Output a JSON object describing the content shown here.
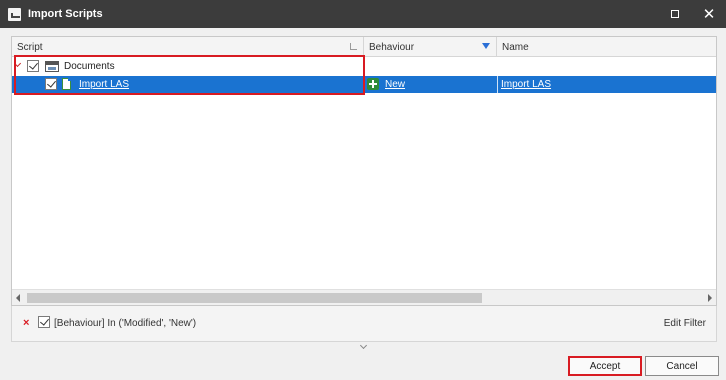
{
  "window": {
    "title": "Import Scripts"
  },
  "grid": {
    "columns": {
      "script": "Script",
      "behaviour": "Behaviour",
      "name": "Name"
    },
    "rows": [
      {
        "script": "Documents",
        "checked": true,
        "icon": "folder-icon"
      },
      {
        "script": "Import LAS",
        "behaviour": "New",
        "name": "Import LAS",
        "checked": true,
        "selected": true,
        "icon": "document-icon"
      }
    ]
  },
  "filter": {
    "text": "[Behaviour] In ('Modified', 'New')",
    "checked": true,
    "edit_label": "Edit Filter"
  },
  "buttons": {
    "accept": "Accept",
    "cancel": "Cancel"
  },
  "colors": {
    "selection": "#1a73d1",
    "highlight": "#d81b22",
    "titlebar": "#3c3c3c"
  }
}
